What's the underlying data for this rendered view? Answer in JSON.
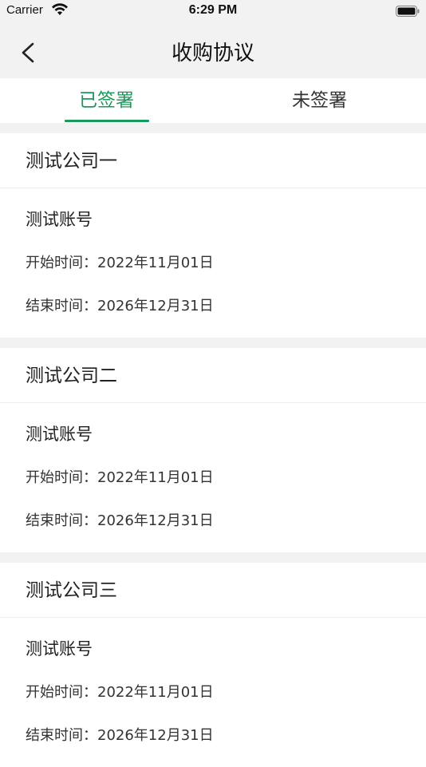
{
  "status_bar": {
    "carrier": "Carrier",
    "time": "6:29 PM"
  },
  "nav": {
    "title": "收购协议",
    "back_icon": "chevron-left-icon"
  },
  "tabs": [
    {
      "label": "已签署",
      "active": true
    },
    {
      "label": "未签署",
      "active": false
    }
  ],
  "colors": {
    "accent": "#1a9a5a",
    "background": "#f2f2f2",
    "card": "#ffffff"
  },
  "agreements": [
    {
      "company": "测试公司一",
      "account": "测试账号",
      "start_label": "开始时间：",
      "start": "2022年11月01日",
      "end_label": "结束时间：",
      "end": "2026年12月31日"
    },
    {
      "company": "测试公司二",
      "account": "测试账号",
      "start_label": "开始时间：",
      "start": "2022年11月01日",
      "end_label": "结束时间：",
      "end": "2026年12月31日"
    },
    {
      "company": "测试公司三",
      "account": "测试账号",
      "start_label": "开始时间：",
      "start": "2022年11月01日",
      "end_label": "结束时间：",
      "end": "2026年12月31日"
    }
  ]
}
